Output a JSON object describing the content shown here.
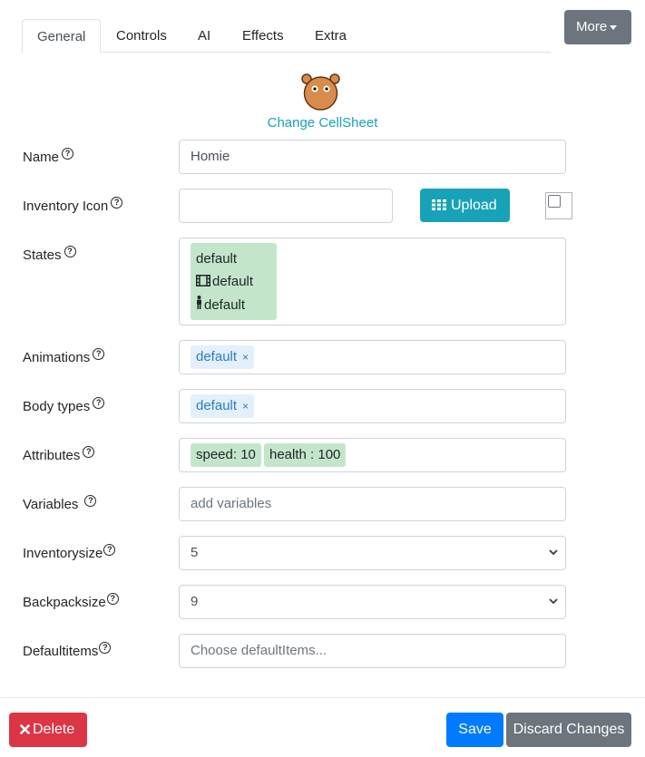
{
  "tabs": [
    {
      "label": "General",
      "active": true
    },
    {
      "label": "Controls",
      "active": false
    },
    {
      "label": "AI",
      "active": false
    },
    {
      "label": "Effects",
      "active": false
    },
    {
      "label": "Extra",
      "active": false
    }
  ],
  "more_button": {
    "label": "More"
  },
  "avatar": {
    "icon": "monkey-face-icon"
  },
  "change_cellsheet": "Change CellSheet",
  "help_icon": "?",
  "fields": {
    "name": {
      "label": "Name",
      "value": "Homie"
    },
    "inventory_icon": {
      "label": "Inventory Icon",
      "value": "",
      "upload_label": "Upload"
    },
    "states": {
      "label": "States",
      "items": [
        "default",
        "default",
        "default"
      ]
    },
    "animations": {
      "label": "Animations",
      "tags": [
        "default"
      ]
    },
    "body_types": {
      "label": "Body types",
      "tags": [
        "default"
      ]
    },
    "attributes": {
      "label": "Attributes",
      "tags": [
        "speed: 10",
        "health : 100"
      ]
    },
    "variables": {
      "label": "Variables",
      "placeholder": "add variables"
    },
    "inventorysize": {
      "label": "Inventorysize",
      "value": "5"
    },
    "backpacksize": {
      "label": "Backpacksize",
      "value": "9"
    },
    "defaultitems": {
      "label": "Defaultitems",
      "placeholder": "Choose defaultItems..."
    }
  },
  "tag_remove": "×",
  "footer": {
    "delete_label": "Delete",
    "save_label": "Save",
    "discard_label": "Discard Changes"
  },
  "colors": {
    "primary": "#007bff",
    "info": "#17a2b8",
    "danger": "#dc3545",
    "secondary": "#6c757d",
    "success_light": "#c3e6cb"
  }
}
